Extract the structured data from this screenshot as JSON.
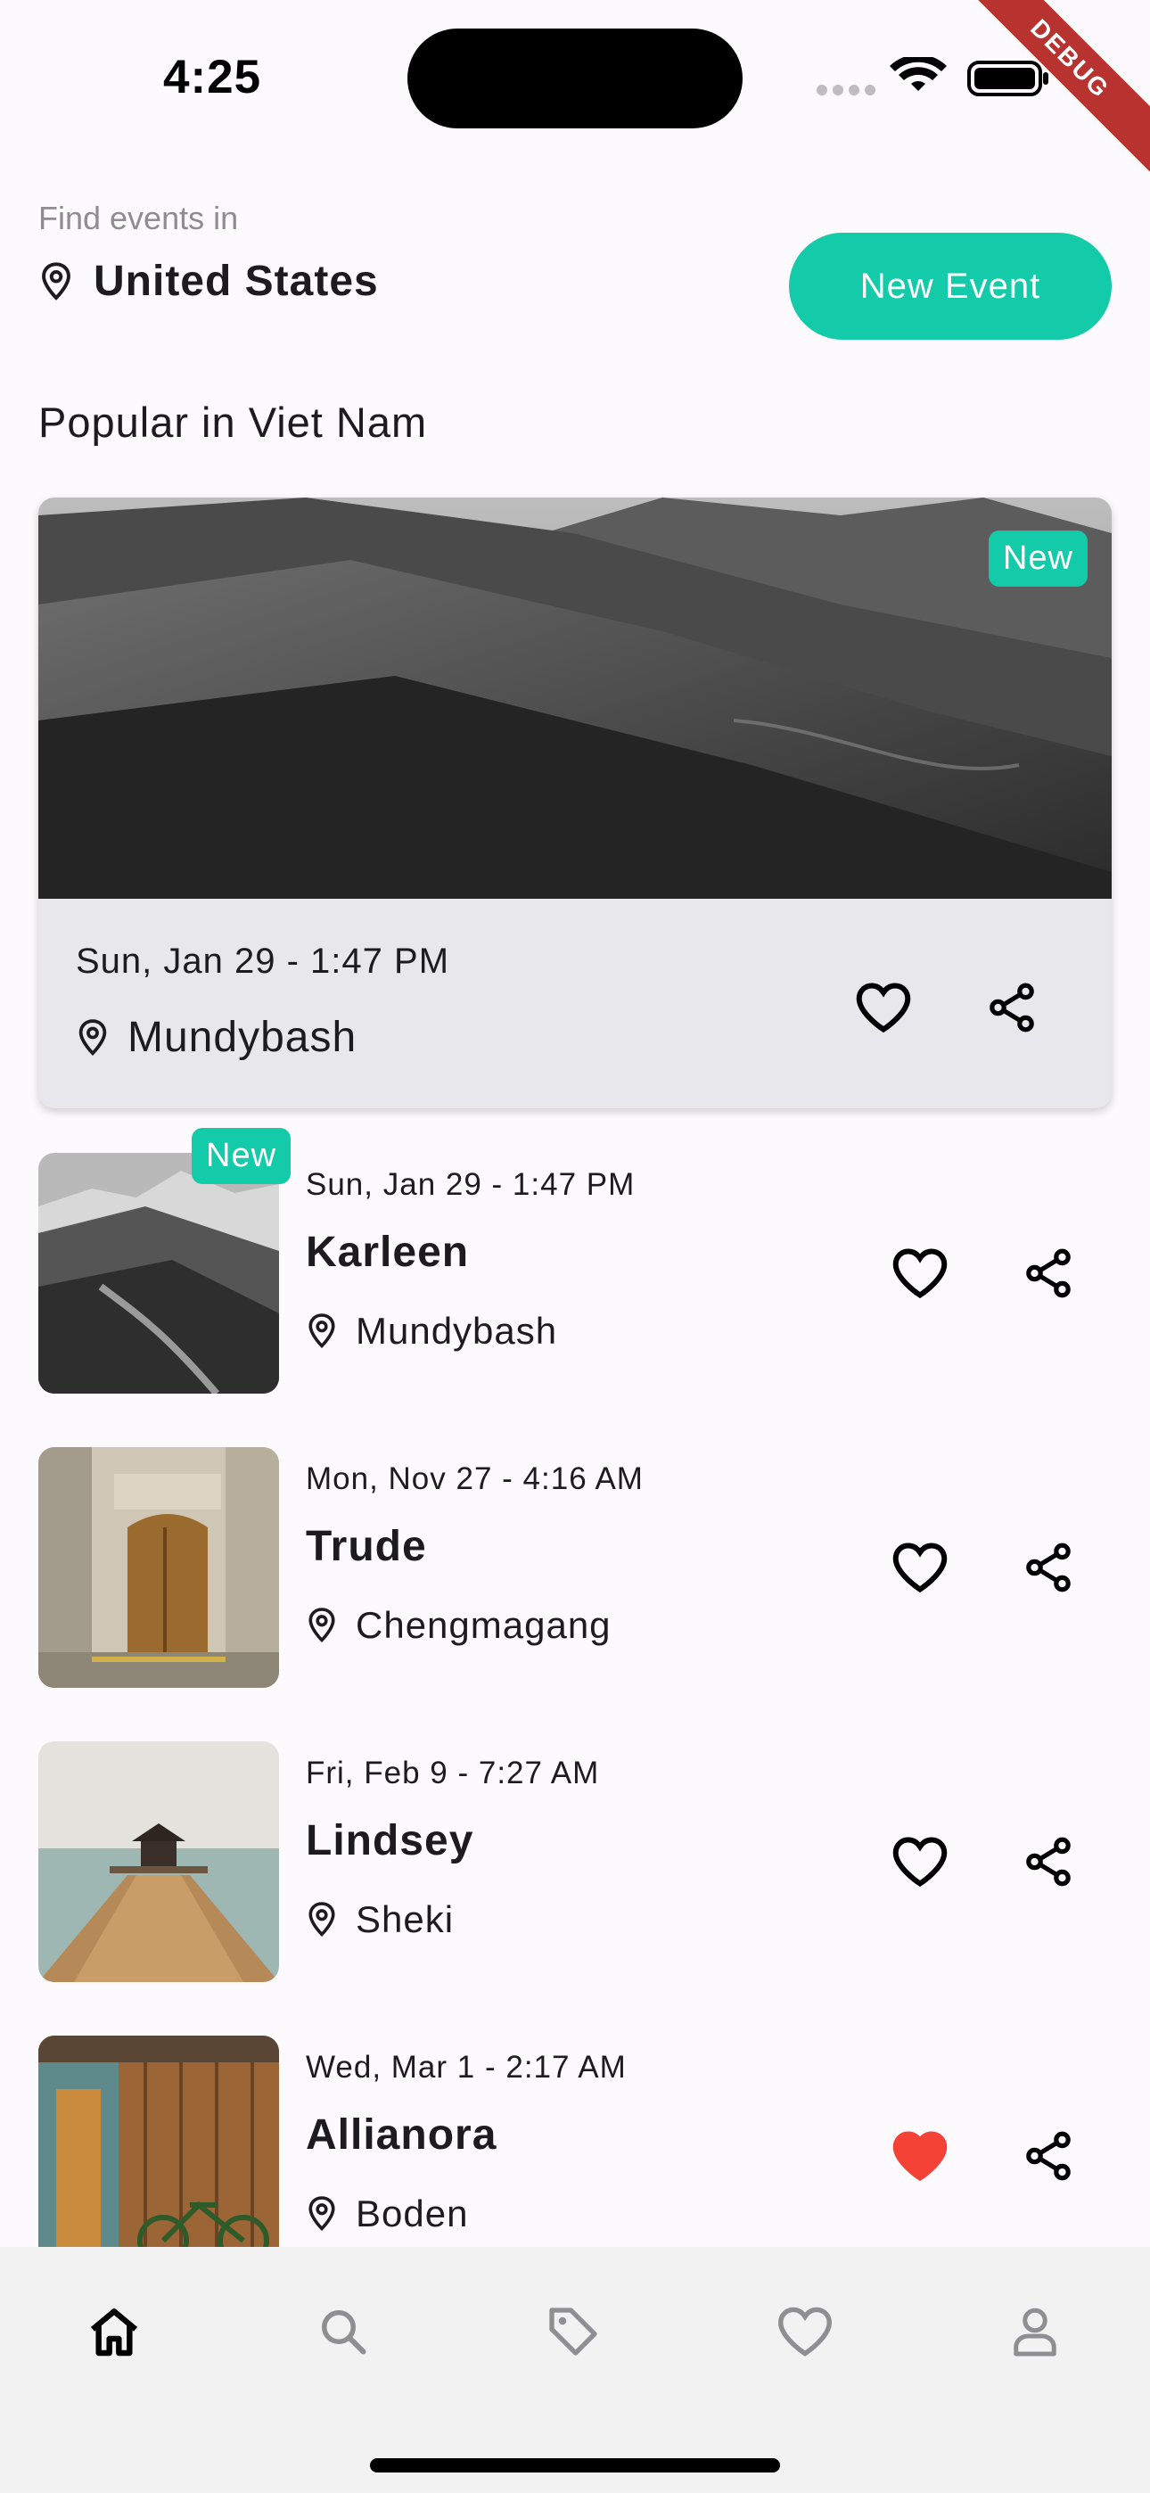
{
  "status_bar": {
    "time": "4:25",
    "debug_label": "DEBUG"
  },
  "header": {
    "find_label": "Find events in",
    "country": "United States",
    "new_event_label": "New Event",
    "location_icon": "location-pin-icon"
  },
  "section": {
    "title": "Popular in Viet Nam"
  },
  "featured": {
    "badge": "New",
    "date": "Sun, Jan 29 - 1:47 PM",
    "location": "Mundybash",
    "favorite": false
  },
  "events": [
    {
      "badge": "New",
      "date": "Sun, Jan 29 - 1:47 PM",
      "title": "Karleen",
      "location": "Mundybash",
      "favorite": false
    },
    {
      "badge": "",
      "date": "Mon, Nov 27 - 4:16 AM",
      "title": "Trude",
      "location": "Chengmagang",
      "favorite": false
    },
    {
      "badge": "",
      "date": "Fri, Feb 9 - 7:27 AM",
      "title": "Lindsey",
      "location": "Sheki",
      "favorite": false
    },
    {
      "badge": "",
      "date": "Wed, Mar 1 - 2:17 AM",
      "title": "Allianora",
      "location": "Boden",
      "favorite": true
    }
  ],
  "bottom_nav": {
    "items": [
      "home-icon",
      "search-icon",
      "tag-icon",
      "heart-icon",
      "profile-icon"
    ],
    "active": "home-icon"
  },
  "colors": {
    "accent": "#13cba8",
    "favorite_active": "#f44336",
    "debug": "#b8332f"
  }
}
